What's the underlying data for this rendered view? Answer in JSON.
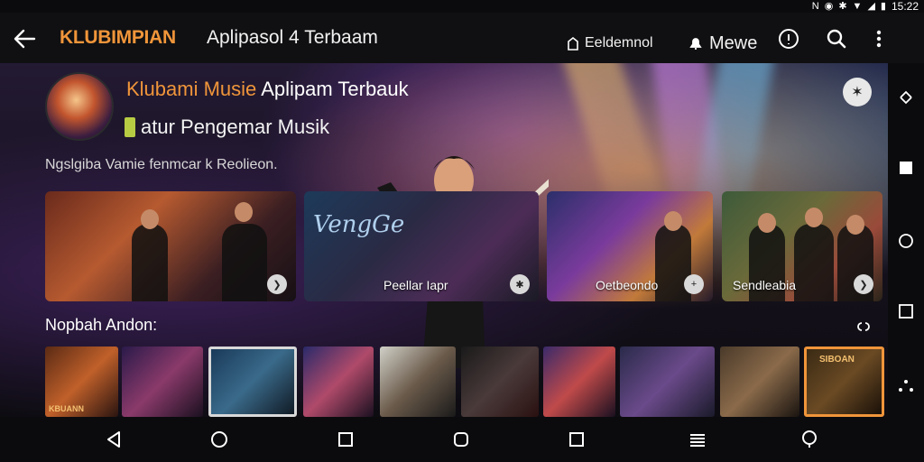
{
  "status_bar": {
    "time": "15:22",
    "icons": [
      "nfc-icon",
      "settings-icon",
      "bluetooth-icon",
      "wifi-icon",
      "signal-icon",
      "battery-icon"
    ]
  },
  "app_bar": {
    "brand": "KLUBIMPIAN",
    "title": "Aplipasol 4 Terbaam",
    "tabs": [
      {
        "label": "Eeldemnol",
        "active": true
      },
      {
        "label": "Mewe",
        "active": false
      }
    ],
    "accent": "#f0953a",
    "tab_indicator_color": "#e06b4a"
  },
  "hero": {
    "title_part1": "Klubami Musie",
    "title_part2": "Aplipam Terbauk",
    "subtitle": "atur Pengemar Musik",
    "description": "Ngslgiba Vamie fenmcar k Reolieon."
  },
  "featured_cards": [
    {
      "label": "",
      "badge": "❯"
    },
    {
      "label": "Peellar Iapr",
      "overlay_text": "VengGe",
      "badge": "✱"
    },
    {
      "label": "Oetbeondo",
      "badge": "+"
    },
    {
      "label": "Sendleabia",
      "badge": "❯"
    }
  ],
  "section": {
    "title": "Nopbah Andon:",
    "more_icon": "link-icon"
  },
  "thumbnails": [
    {
      "label": "KBUANN",
      "selected": false,
      "highlighted": false
    },
    {
      "label": "",
      "selected": false,
      "highlighted": false
    },
    {
      "label": "",
      "selected": true,
      "highlighted": false
    },
    {
      "label": "",
      "selected": false,
      "highlighted": false
    },
    {
      "label": "",
      "selected": false,
      "highlighted": false
    },
    {
      "label": "",
      "selected": false,
      "highlighted": false
    },
    {
      "label": "",
      "selected": false,
      "highlighted": false
    },
    {
      "label": "",
      "selected": false,
      "highlighted": false
    },
    {
      "label": "",
      "selected": false,
      "highlighted": false
    },
    {
      "label": "SIBOAN",
      "selected": false,
      "highlighted": true
    }
  ],
  "nav_bar": [
    "back-triangle-icon",
    "home-circle-icon",
    "recents-square-icon",
    "rounded-square-icon",
    "square-icon",
    "menu-lines-icon",
    "search-circle-icon"
  ],
  "side_rail": [
    "share-icon",
    "square-filled-icon",
    "circle-icon",
    "square-outline-icon",
    "dots-icon"
  ]
}
